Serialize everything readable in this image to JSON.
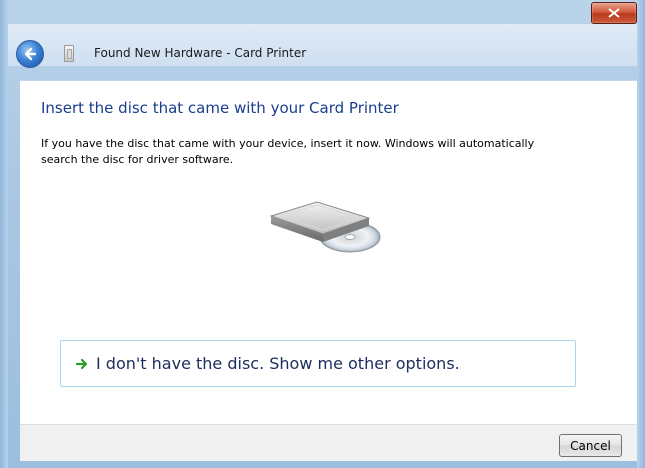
{
  "window": {
    "title": "Found New Hardware - Card Printer",
    "close_glyph": "x"
  },
  "content": {
    "heading": "Insert the disc that came with your Card Printer",
    "description": "If you have the disc that came with your device, insert it now.  Windows will automatically search the disc for driver software.",
    "option_label": "I don't have the disc.  Show me other options."
  },
  "footer": {
    "cancel_label": "Cancel"
  },
  "colors": {
    "heading": "#1a3e8f",
    "option_border": "#a9d6ee",
    "arrow": "#2a9a2a"
  }
}
